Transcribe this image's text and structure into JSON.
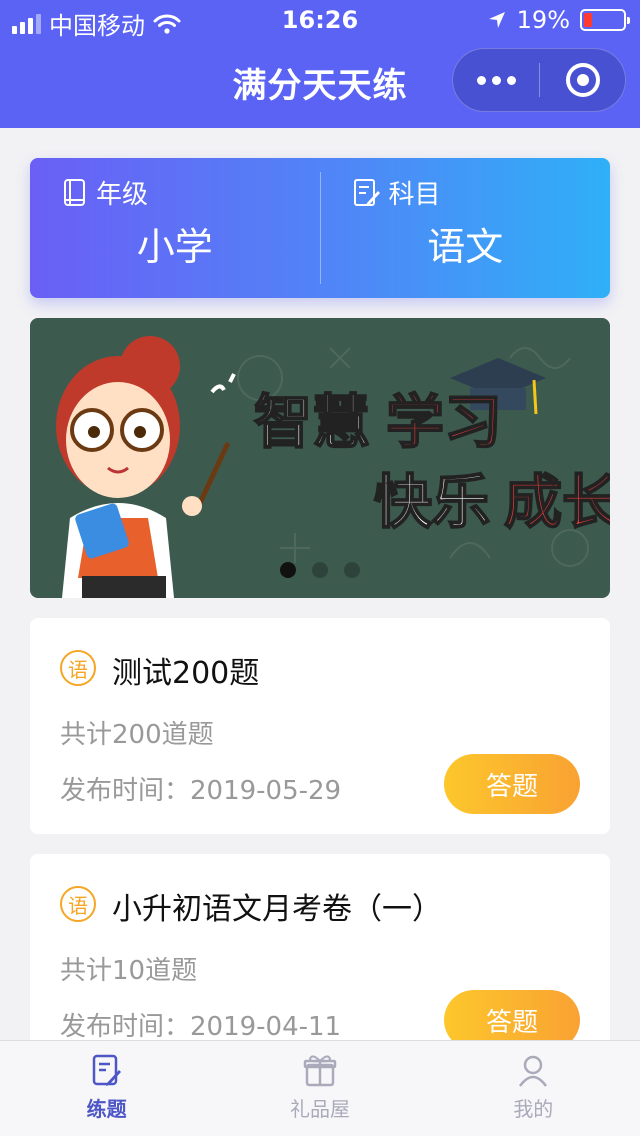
{
  "status_bar": {
    "carrier": "中国移动",
    "time": "16:26",
    "battery": "19%"
  },
  "header": {
    "title": "满分天天练"
  },
  "selector": {
    "grade": {
      "label": "年级",
      "value": "小学"
    },
    "subject": {
      "label": "科目",
      "value": "语文"
    }
  },
  "banner": {
    "line1_a": "智慧",
    "line1_b": "学习",
    "line2_a": "快乐",
    "line2_b": "成长",
    "active_index": 0
  },
  "exams": [
    {
      "badge": "语",
      "title": "测试200题",
      "count": "共计200道题",
      "date": "发布时间：2019-05-29",
      "action": "答题"
    },
    {
      "badge": "语",
      "title": "小升初语文月考卷（一）",
      "count": "共计10道题",
      "date": "发布时间：2019-04-11",
      "action": "答题"
    }
  ],
  "tabs": [
    {
      "label": "练题",
      "icon": "practice-icon",
      "active": true
    },
    {
      "label": "礼品屋",
      "icon": "gift-icon",
      "active": false
    },
    {
      "label": "我的",
      "icon": "profile-icon",
      "active": false
    }
  ],
  "colors": {
    "header": "#5b63f5",
    "accent": "#f5a623",
    "tab_active": "#4d56c6"
  }
}
